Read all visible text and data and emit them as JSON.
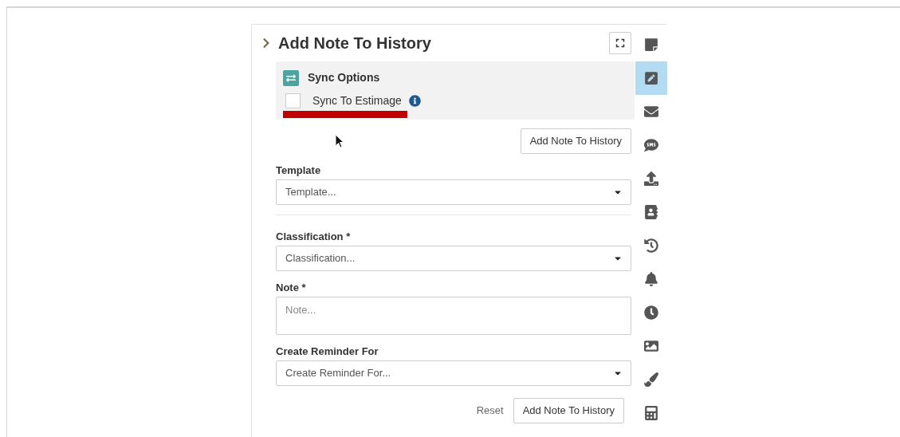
{
  "panel": {
    "title": "Add Note To History",
    "expanded": false
  },
  "sync_options": {
    "title": "Sync Options",
    "checkbox": {
      "label": "Sync To Estimage",
      "checked": false
    }
  },
  "top_button": "Add Note To History",
  "fields": [
    {
      "kind": "select",
      "label": "Template",
      "placeholder": "Template..."
    },
    {
      "kind": "divider"
    },
    {
      "kind": "select",
      "label": "Classification *",
      "placeholder": "Classification..."
    },
    {
      "kind": "textarea",
      "label": "Note *",
      "placeholder": "Note..."
    },
    {
      "kind": "select",
      "label": "Create Reminder For",
      "placeholder": "Create Reminder For..."
    }
  ],
  "footer": {
    "reset": "Reset",
    "submit": "Add Note To History"
  },
  "sidebar": {
    "items": [
      {
        "selected": false
      },
      {
        "selected": true
      },
      {
        "selected": false
      },
      {
        "selected": false
      },
      {
        "selected": false
      },
      {
        "selected": false
      },
      {
        "selected": false
      },
      {
        "selected": false
      },
      {
        "selected": false
      },
      {
        "selected": false
      },
      {
        "selected": false
      },
      {
        "selected": false
      }
    ]
  }
}
